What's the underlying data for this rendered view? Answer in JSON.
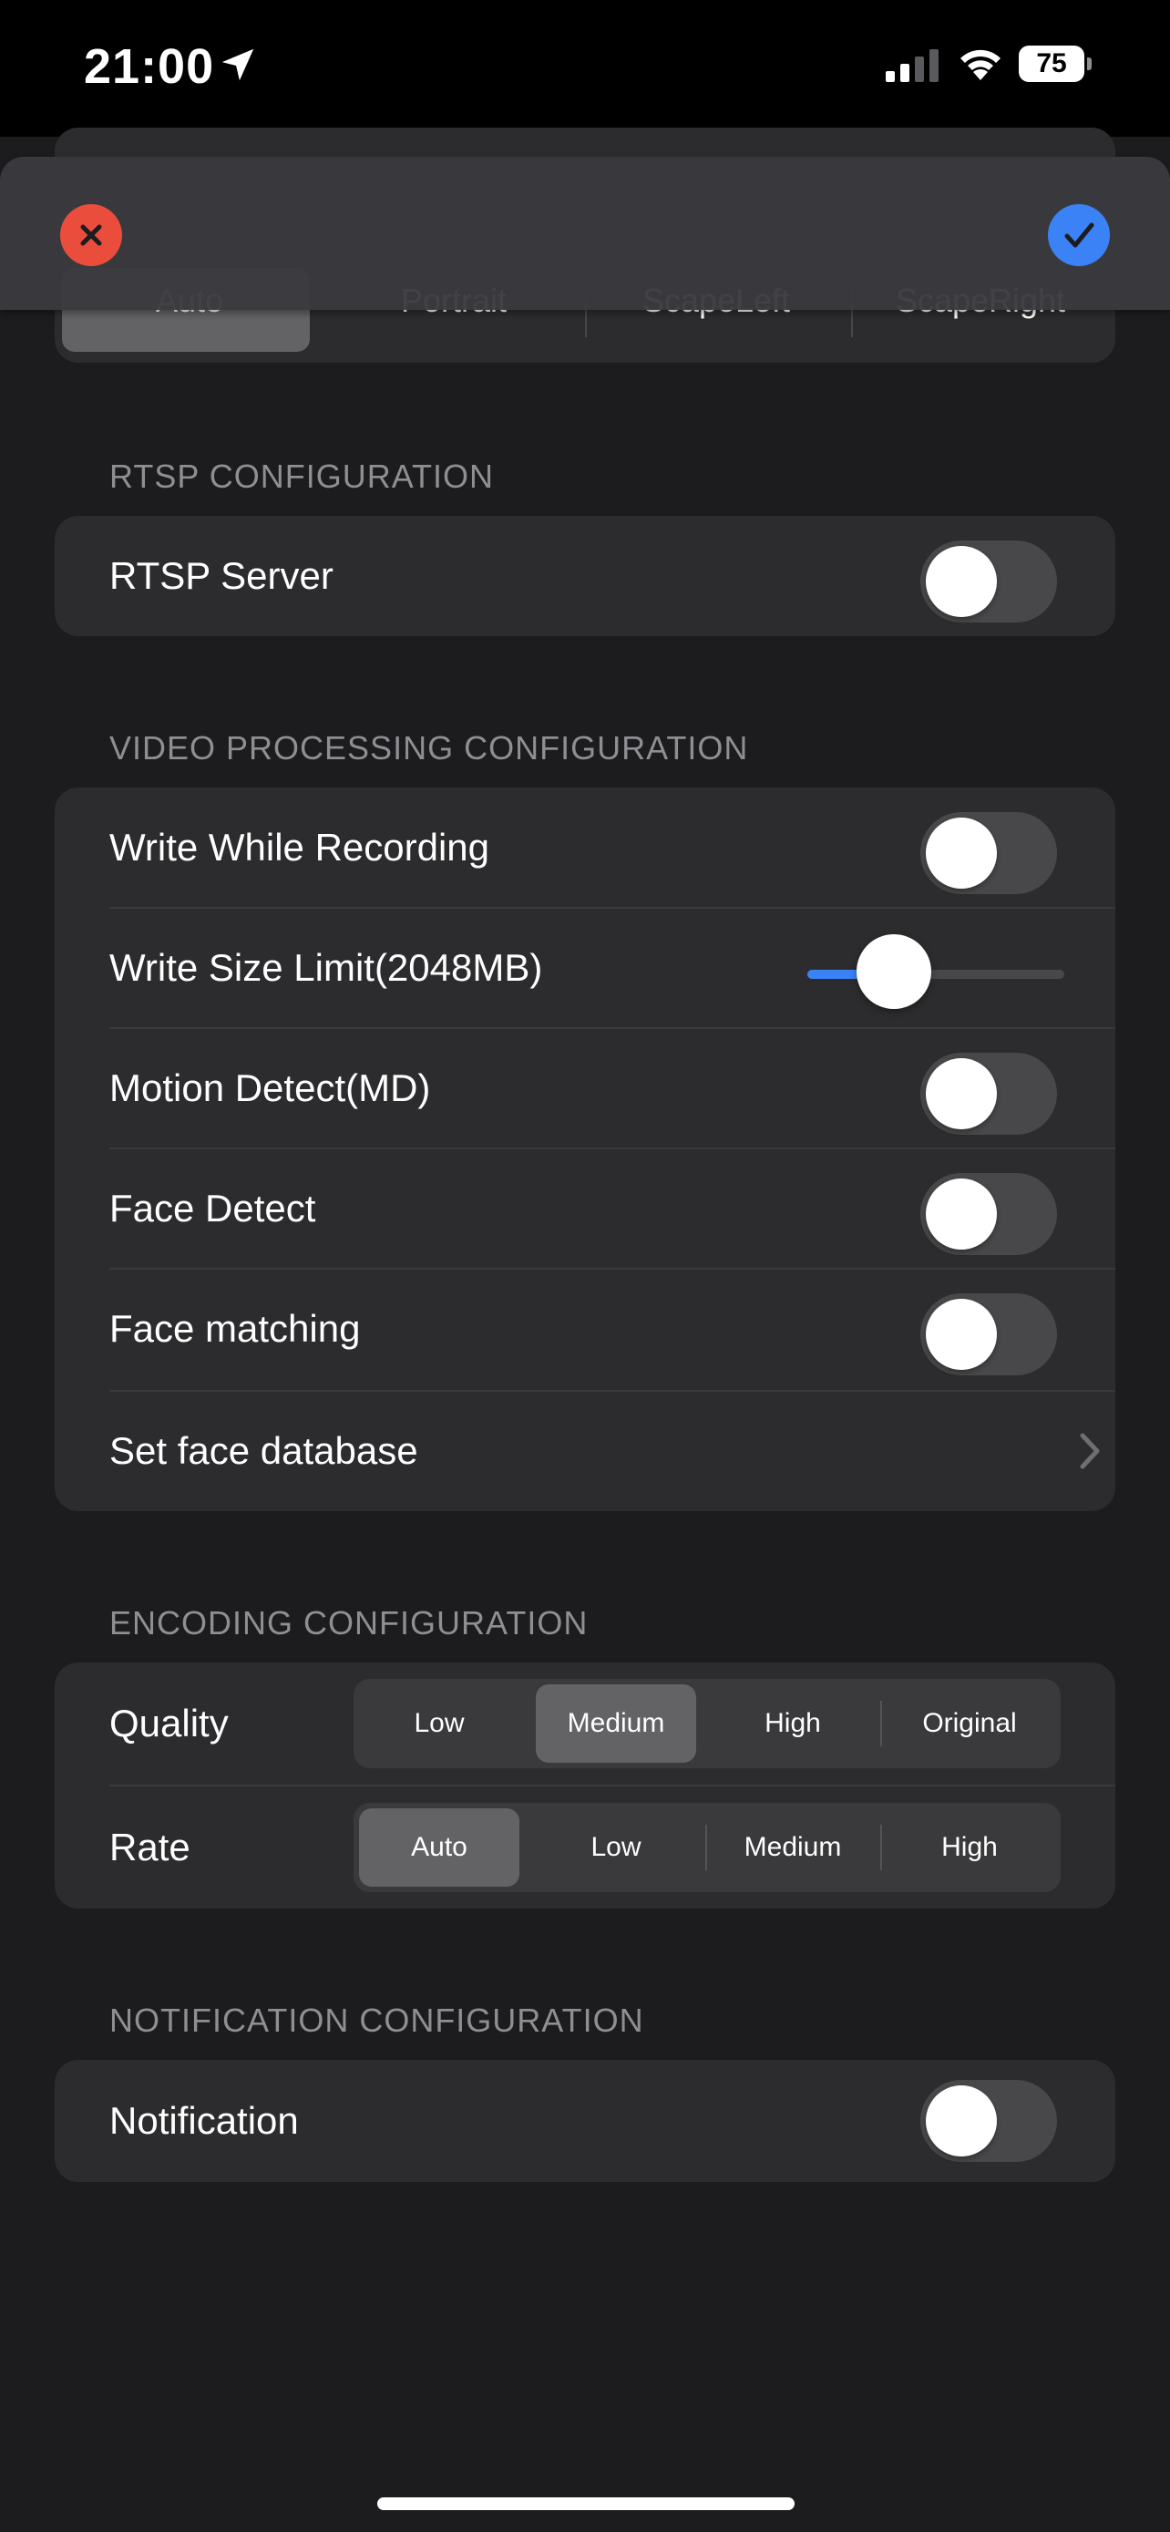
{
  "status_bar": {
    "time": "21:00",
    "battery": "75"
  },
  "orientation": {
    "options": [
      "Auto",
      "Portrait",
      "ScapeLeft",
      "ScapeRight"
    ],
    "selected": "Auto"
  },
  "rtsp": {
    "header": "RTSP CONFIGURATION",
    "server_label": "RTSP Server",
    "server_on": false
  },
  "video": {
    "header": "VIDEO PROCESSING CONFIGURATION",
    "write_while_recording": "Write While Recording",
    "write_size_limit": "Write Size Limit(2048MB)",
    "write_size_fraction": 0.16,
    "motion_detect": "Motion Detect(MD)",
    "face_detect": "Face Detect",
    "face_matching": "Face matching",
    "set_face_database": "Set face database"
  },
  "encoding": {
    "header": "ENCODING CONFIGURATION",
    "quality_label": "Quality",
    "quality_options": [
      "Low",
      "Medium",
      "High",
      "Original"
    ],
    "quality_selected": "Medium",
    "rate_label": "Rate",
    "rate_options": [
      "Auto",
      "Low",
      "Medium",
      "High"
    ],
    "rate_selected": "Auto"
  },
  "notification": {
    "header": "NOTIFICATION CONFIGURATION",
    "label": "Notification"
  },
  "colors": {
    "accent": "#3b82f6",
    "cancel": "#eb4d3d",
    "background": "#1c1c1e",
    "cell": "#2c2c2e"
  }
}
